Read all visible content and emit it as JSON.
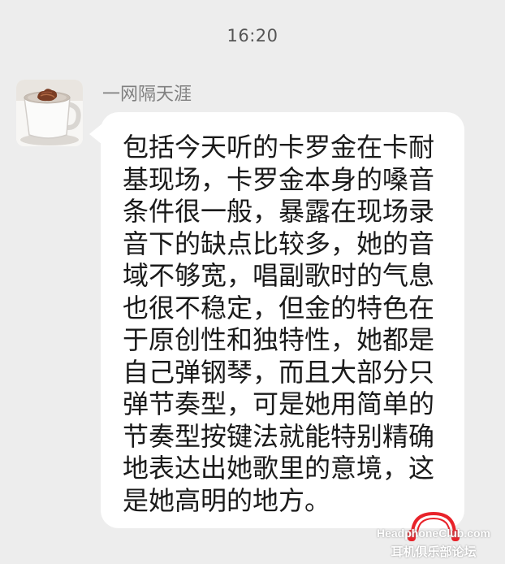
{
  "chat": {
    "timestamp": "16:20",
    "message": {
      "sender_name": "一网隔天涯",
      "avatar_icon": "coffee-cup-avatar",
      "text": "包括今天听的卡罗金在卡耐\n基现场，卡罗金本身的嗓音\n条件很一般，暴露在现场录\n音下的缺点比较多，她的音\n域不够宽，唱副歌时的气息\n也很不稳定，但金的特色在\n于原创性和独特性，她都是\n自己弹钢琴，而且大部分只\n弹节奏型，可是她用简单的\n节奏型按键法就能特别精确\n地表达出她歌里的意境，这\n是她高明的地方。"
    }
  },
  "watermark": {
    "brand": "HeadphoneClub.com",
    "subtitle": "耳机俱乐部论坛",
    "accent_color": "#e8232a",
    "icon": "headphone-logo-icon"
  },
  "colors": {
    "background": "#ededed",
    "bubble": "#ffffff",
    "name_text": "#808080",
    "timestamp_text": "#555555",
    "message_text": "#1a1a1a"
  }
}
